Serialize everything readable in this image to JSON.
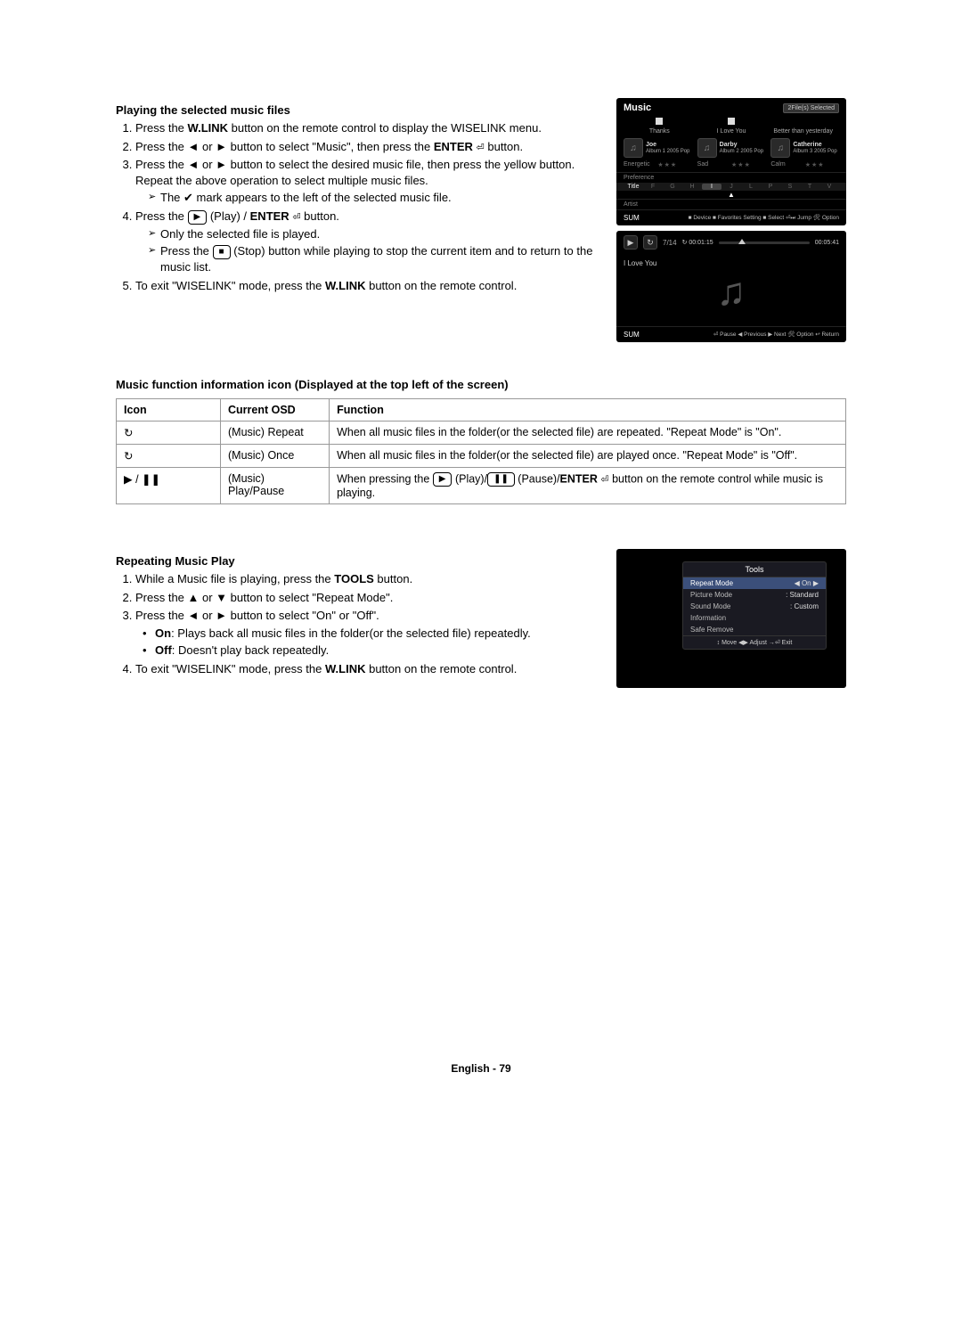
{
  "section1_title": "Playing the selected music files",
  "step1a": "Press the ",
  "step1b": "W.LINK",
  "step1c": " button on the remote control to display the WISELINK menu.",
  "step2a": "Press the ◄ or ► button to select \"Music\", then press the ",
  "step2b": "ENTER",
  "step2c": " button.",
  "step3": "Press the ◄ or ► button to select the desired music file, then press the yellow button. Repeat the above operation to select multiple music files.",
  "step3_sub": "The ✔ mark appears to the left of the selected music file.",
  "step4a": "Press the ",
  "step4b": " (Play) / ",
  "step4c": "ENTER",
  "step4d": " button.",
  "step4_sub1": "Only the selected file is played.",
  "step4_sub2a": "Press the ",
  "step4_sub2b": " (Stop) button while playing to stop the current item and to return to the music list.",
  "step5a": "To exit \"WISELINK\" mode, press the ",
  "step5b": "W.LINK",
  "step5c": " button on the remote control.",
  "info_heading": "Music function information icon (Displayed at the top left of the screen)",
  "table": {
    "h1": "Icon",
    "h2": "Current OSD",
    "h3": "Function",
    "r1_icon": "↻",
    "r1_osd": "(Music) Repeat",
    "r1_fn": "When all music files in the folder(or the selected file) are repeated. \"Repeat Mode\" is \"On\".",
    "r2_icon": "↻",
    "r2_osd": "(Music) Once",
    "r2_fn": "When all music files in the folder(or the selected file) are played once. \"Repeat Mode\" is \"Off\".",
    "r3_icon": "▶ / ❚❚",
    "r3_osd": "(Music) Play/Pause",
    "r3_fn_a": "When pressing the ",
    "r3_fn_b": " (Play)/",
    "r3_fn_c": " (Pause)/",
    "r3_fn_d": "ENTER",
    "r3_fn_e": " button on the remote control while music is playing."
  },
  "section2_title": "Repeating Music Play",
  "rstep1a": "While a Music file is playing, press the ",
  "rstep1b": "TOOLS",
  "rstep1c": " button.",
  "rstep2": "Press the ▲ or ▼ button to select \"Repeat Mode\".",
  "rstep3": "Press the ◄ or ► button to select \"On\" or \"Off\".",
  "rbul_on_a": "On",
  "rbul_on_b": ": Plays back all music files in the folder(or the selected file) repeatedly.",
  "rbul_off_a": "Off",
  "rbul_off_b": ": Doesn't play back repeatedly.",
  "rstep4a": "To exit \"WISELINK\" mode, press the ",
  "rstep4b": "W.LINK",
  "rstep4c": " button on the remote control.",
  "ss": {
    "title": "Music",
    "badge": "2File(s) Selected",
    "songs": {
      "a": "Thanks",
      "b": "I Love You",
      "c": "Better than yesterday"
    },
    "artists": {
      "a": "Joe",
      "b": "Darby",
      "c": "Catherine"
    },
    "album_meta": "Album 1\n2005\nPop",
    "album_meta2": "Album 2\n2005\nPop",
    "album_meta3": "Album 3\n2005\nPop",
    "moods": {
      "a": "Energetic",
      "b": "Sad",
      "c": "Calm"
    },
    "pref": "Preference",
    "title_l": "Title",
    "artist_l": "Artist",
    "alpha": [
      "F",
      "G",
      "H",
      "I",
      "J",
      "L",
      "P",
      "S",
      "T",
      "V"
    ],
    "sum": "SUM",
    "footer_r": "■ Device ■ Favorites Setting ■ Select ⏎⏭ Jump 🛠 Option"
  },
  "pl": {
    "idx": "7/14",
    "cur": "00:01:15",
    "tot": "00:05:41",
    "song": "I Love You",
    "sum": "SUM",
    "footer_r": "⏎ Pause ◀ Previous ▶ Next 🛠 Option ↩ Return"
  },
  "tools": {
    "title": "Tools",
    "rows": [
      {
        "label": "Repeat Mode",
        "val": "On",
        "sel": true,
        "arrows": true
      },
      {
        "label": "Picture Mode",
        "val": "Standard",
        "sep": ":"
      },
      {
        "label": "Sound Mode",
        "val": "Custom",
        "sep": ":"
      },
      {
        "label": "Information",
        "val": ""
      },
      {
        "label": "Safe Remove",
        "val": ""
      }
    ],
    "hint": "↕ Move   ◀▶ Adjust   →⏎ Exit"
  },
  "footer": {
    "lang": "English - ",
    "page": "79"
  }
}
